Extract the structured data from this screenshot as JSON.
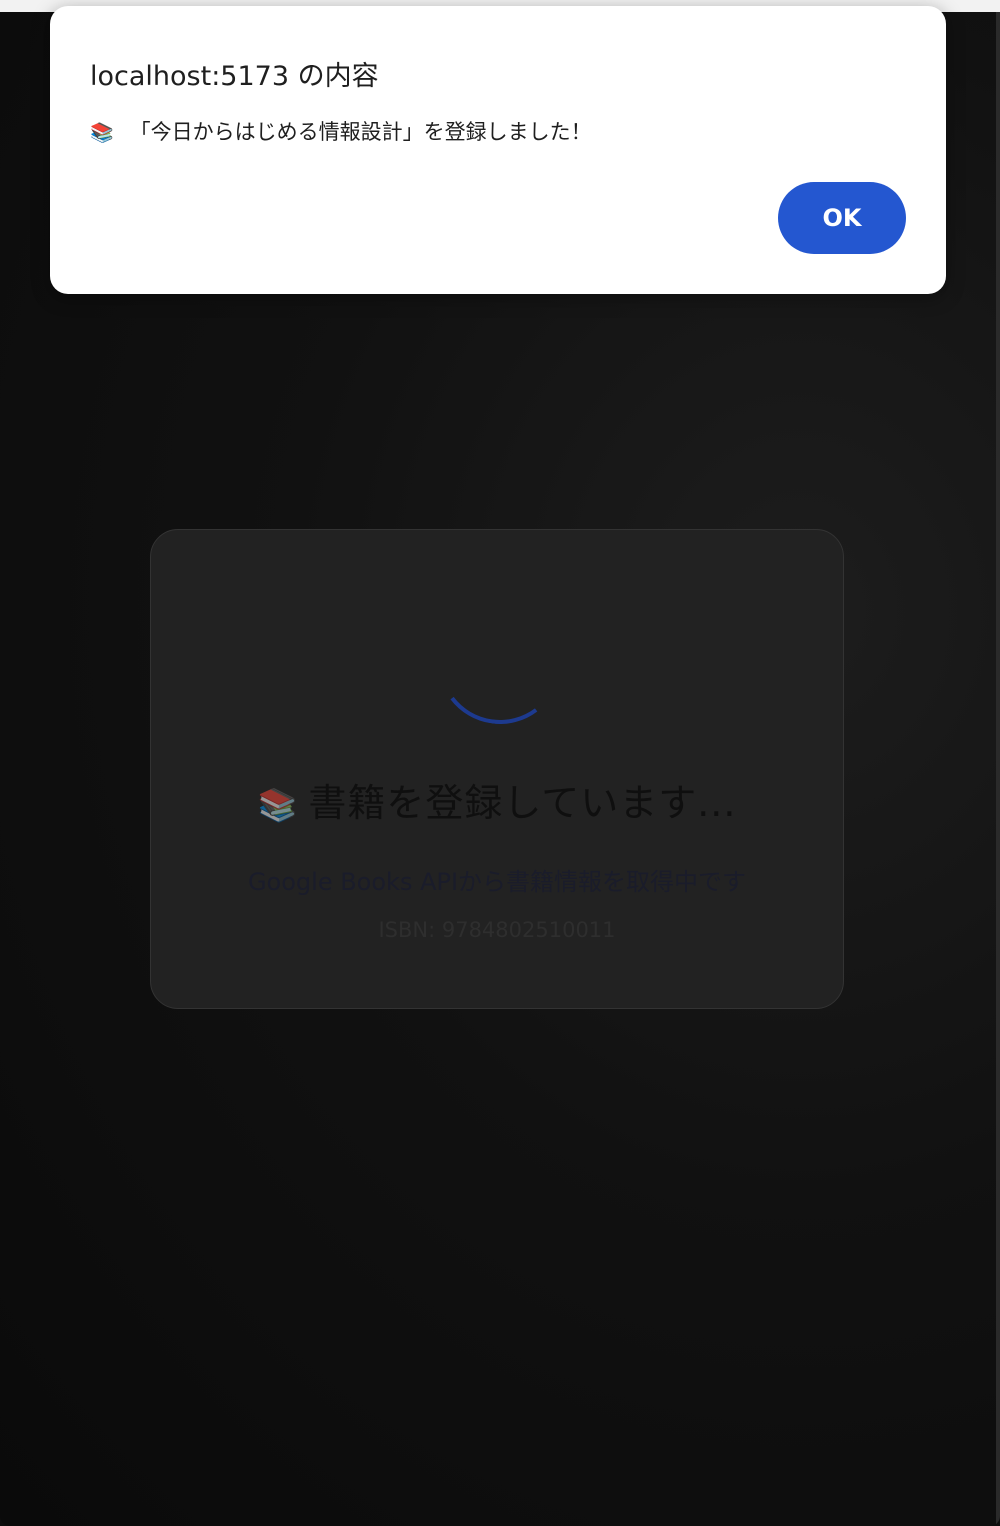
{
  "alert": {
    "title": "localhost:5173 の内容",
    "message_emoji": "📚",
    "message": "「今日からはじめる情報設計」を登録しました！",
    "ok_label": "OK"
  },
  "loading": {
    "emoji": "📚",
    "title": "書籍を登録しています...",
    "subtitle": "Google Books APIから書籍情報を取得中です",
    "isbn_text": "ISBN: 9784802510011"
  },
  "colors": {
    "ok_button": "#2457d0",
    "spinner": "#1d3a8f",
    "overlay_bg": "#0d0d0d"
  },
  "icons": {
    "book": "books-icon",
    "spinner": "loading-spinner-icon"
  }
}
